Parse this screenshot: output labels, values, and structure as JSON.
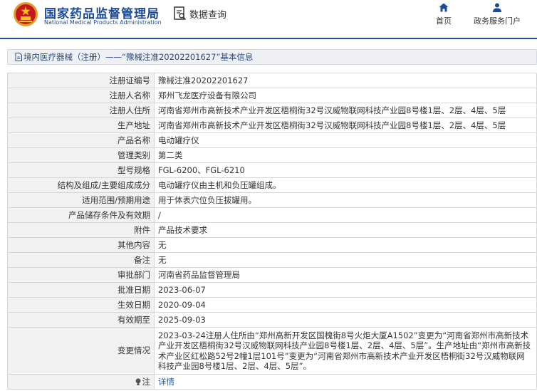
{
  "header": {
    "title_cn": "国家药品监督管理局",
    "title_en": "National Medical Products Administration",
    "query_label": "数据查询",
    "nav": [
      {
        "label": "首页",
        "icon": "home-icon"
      },
      {
        "label": "政务服务门户",
        "icon": "user-icon"
      }
    ]
  },
  "breadcrumb": {
    "text": "境内医疗器械（注册）——“豫械注准20202201627”基本信息"
  },
  "rows": [
    {
      "label": "注册证编号",
      "value": "豫械注准20202201627"
    },
    {
      "label": "注册人名称",
      "value": "郑州飞龙医疗设备有限公司"
    },
    {
      "label": "注册人住所",
      "value": "河南省郑州市高新技术产业开发区梧桐街32号汉威物联网科技产业园8号楼1层、2层、4层、5层"
    },
    {
      "label": "生产地址",
      "value": "河南省郑州市高新技术产业开发区梧桐街32号汉威物联网科技产业园8号楼1层、2层、4层、5层"
    },
    {
      "label": "产品名称",
      "value": "电动罐疗仪"
    },
    {
      "label": "管理类别",
      "value": "第二类"
    },
    {
      "label": "型号规格",
      "value": "FGL-6200、FGL-6210"
    },
    {
      "label": "结构及组成/主要组成成分",
      "value": "电动罐疗仪由主机和负压罐组成。"
    },
    {
      "label": "适用范围/预期用途",
      "value": "用于体表穴位负压拔罐用。"
    },
    {
      "label": "产品储存条件及有效期",
      "value": "/"
    },
    {
      "label": "附件",
      "value": "产品技术要求"
    },
    {
      "label": "其他内容",
      "value": "无"
    },
    {
      "label": "备注",
      "value": "无"
    },
    {
      "label": "审批部门",
      "value": "河南省药品监督管理局"
    },
    {
      "label": "批准日期",
      "value": "2023-06-07"
    },
    {
      "label": "生效日期",
      "value": "2020-09-04"
    },
    {
      "label": "有效期至",
      "value": "2025-09-03"
    }
  ],
  "change": {
    "label": "变更情况",
    "value": "2023-03-24注册人住所由“郑州高新开发区国槐街8号火炬大厦A1502”变更为“河南省郑州市高新技术产业开发区梧桐街32号汉威物联网科技产业园8号楼1层、2层、4层、5层”。生产地址由“郑州市高新技术产业区红松路52号2幢1层101号”变更为“河南省郑州市高新技术产业开发区梧桐街32号汉威物联网科技产业园8号楼1层、2层、4层、5层”。"
  },
  "note": {
    "label": "注",
    "link": "详情"
  },
  "colors": {
    "brand": "#1b4a9a",
    "label_bg": "#f1f1f1",
    "border": "#d6d6d6",
    "link": "#1a5fb4"
  }
}
